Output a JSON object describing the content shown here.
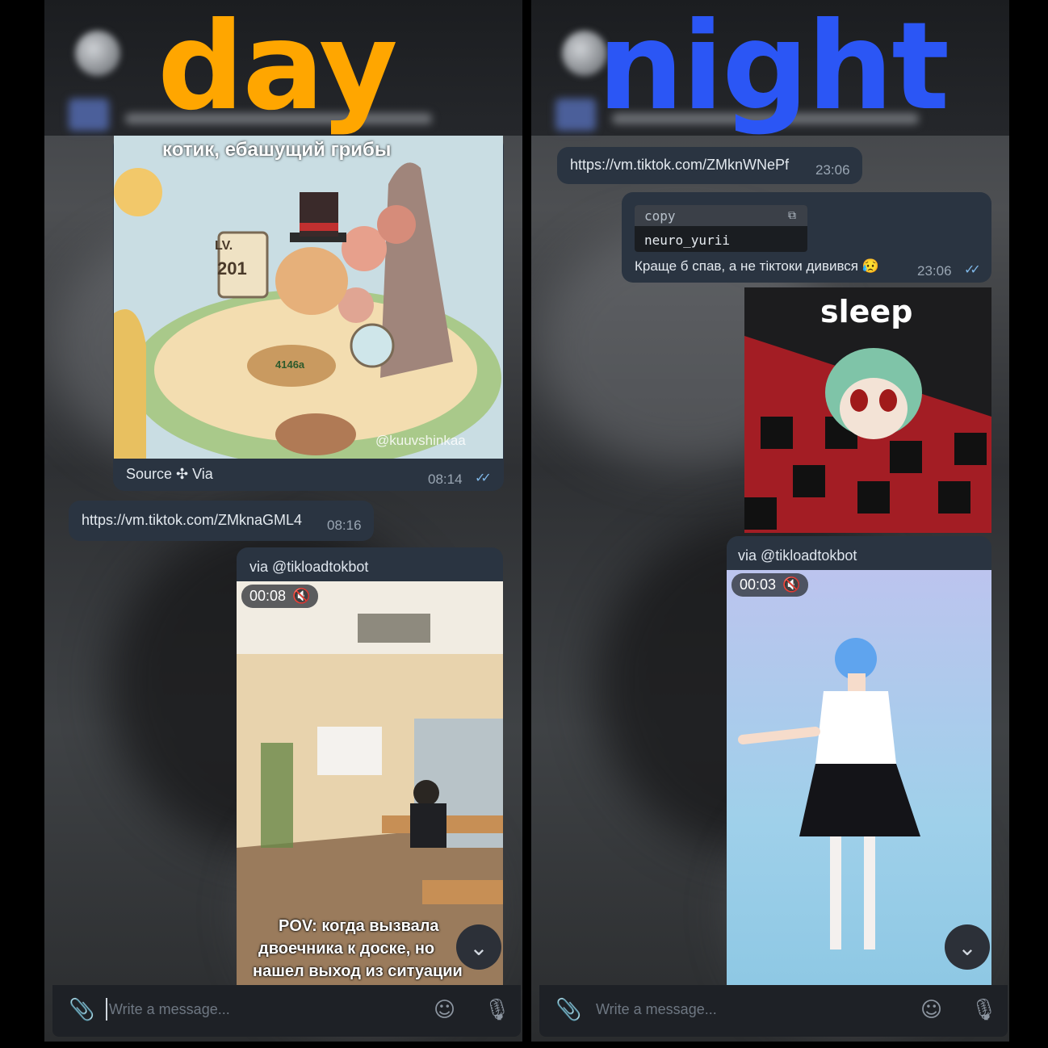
{
  "labels": {
    "day": "day",
    "night": "night"
  },
  "left": {
    "sticker_caption": "котик, ебашущий грибы",
    "sign_top": "LV.",
    "sign_num": "201",
    "coin_text": "4146a",
    "watermark": "@kuuvshinkaa",
    "source_line": "Source ✣ Via",
    "time_1": "08:14",
    "link_1": "https://vm.tiktok.com/ZMknaGML4",
    "time_2": "08:16",
    "via": "via @tikloadtokbot",
    "duration": "00:08",
    "video_caption_1": "POV: когда вызвала",
    "video_caption_2": "двоечника к доске, но",
    "video_caption_3": "нашел выход из ситуации",
    "placeholder": "Write a message..."
  },
  "right": {
    "link_1": "https://vm.tiktok.com/ZMknWNePf",
    "time_1": "23:06",
    "copy_label": "copy",
    "copy_value": "neuro_yurii",
    "message": "Краще б спав, а не тіктоки дивився 😥",
    "time_2": "23:06",
    "sticker_text": "sleep",
    "via": "via @tikloadtokbot",
    "duration": "00:03",
    "placeholder": "Write a message..."
  },
  "colors": {
    "day": "#ffa600",
    "night": "#2b56f5",
    "bubble": "#2a3441",
    "check": "#7fb6e6"
  },
  "icons": [
    "attach-icon",
    "emoji-icon",
    "mic-icon",
    "mute-icon",
    "chevron-down-icon",
    "copy-icon",
    "double-check-icon"
  ]
}
